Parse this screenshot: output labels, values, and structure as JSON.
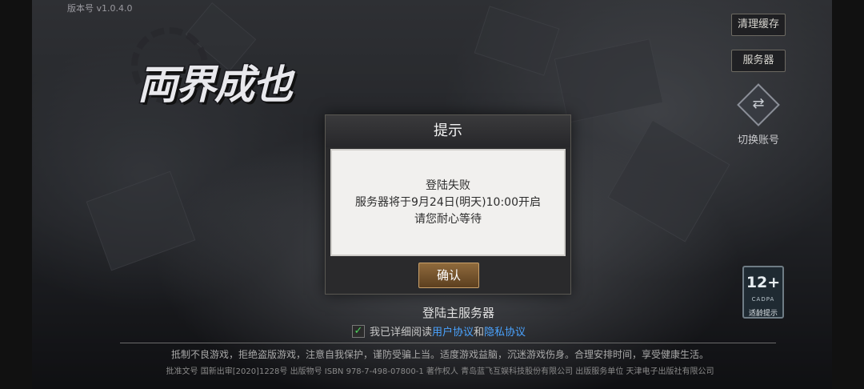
{
  "version": "版本号 v1.0.4.0",
  "logo_text": "両界成也",
  "buttons": {
    "clear_cache": "清理缓存",
    "server": "服务器",
    "switch_account": "切换账号"
  },
  "age_rating": {
    "value": "12+",
    "org": "CADPA",
    "tip": "适龄提示"
  },
  "dialog": {
    "title": "提示",
    "lines": [
      "登陆失败",
      "服务器将于9月24日(明天)10:00开启",
      "请您耐心等待"
    ],
    "confirm": "确认"
  },
  "login_main": "登陆主服务器",
  "agreement": {
    "checked": true,
    "prefix": "我已详细阅读",
    "user_agreement": "用户协议",
    "and": "和",
    "privacy": "隐私协议"
  },
  "footer": {
    "health_notice": "抵制不良游戏，拒绝盗版游戏，注意自我保护，谨防受骗上当。适度游戏益脑，沉迷游戏伤身。合理安排时间，享受健康生活。",
    "license": "批准文号 国新出审[2020]1228号 出版物号 ISBN 978-7-498-07800-1 著作权人 青岛蓝飞互娱科技股份有限公司 出版服务单位 天津电子出版社有限公司"
  },
  "colors": {
    "confirm_button": "#7a5630",
    "link": "#4aa3ff",
    "checkbox": "#4cd35c"
  }
}
